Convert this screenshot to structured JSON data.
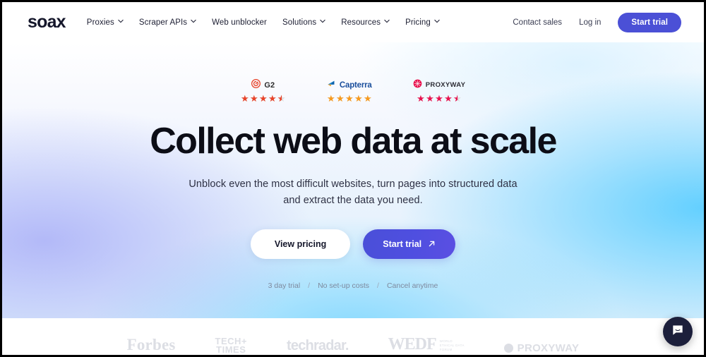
{
  "brand": {
    "logo_text": "soax"
  },
  "nav": {
    "items": [
      {
        "label": "Proxies",
        "has_dropdown": true
      },
      {
        "label": "Scraper APIs",
        "has_dropdown": true
      },
      {
        "label": "Web unblocker",
        "has_dropdown": false
      },
      {
        "label": "Solutions",
        "has_dropdown": true
      },
      {
        "label": "Resources",
        "has_dropdown": true
      },
      {
        "label": "Pricing",
        "has_dropdown": true
      }
    ],
    "contact_sales": "Contact sales",
    "log_in": "Log in",
    "start_trial": "Start trial"
  },
  "badges": [
    {
      "name": "G2",
      "rating": 4.5,
      "star_color": "#e8442a",
      "mark": "g2"
    },
    {
      "name": "Capterra",
      "rating": 5,
      "star_color": "#f79a1e",
      "mark": "capterra"
    },
    {
      "name": "PROXYWAY",
      "rating": 4.5,
      "star_color": "#e8134f",
      "mark": "proxyway"
    }
  ],
  "hero": {
    "headline": "Collect web data at scale",
    "subhead_line1": "Unblock even the most difficult websites, turn pages into structured data",
    "subhead_line2": "and extract the data you need.",
    "cta_primary": "Start trial",
    "cta_secondary": "View pricing",
    "trial_meta": [
      "3 day trial",
      "No set-up costs",
      "Cancel anytime"
    ],
    "trial_separator": "/"
  },
  "logo_strip": {
    "brands": [
      {
        "name": "Forbes",
        "text": "Forbes"
      },
      {
        "name": "Tech Times",
        "line1": "TECH+",
        "line2": "TIMES"
      },
      {
        "name": "techradar",
        "text": "techradar."
      },
      {
        "name": "WEDF",
        "text": "WEDF",
        "sub1": "WORLD",
        "sub2": "ETHICAL DATA",
        "sub3": "FORUM"
      },
      {
        "name": "PROXYWAY",
        "text": "PROXYWAY"
      }
    ]
  },
  "chat": {
    "label": "Open chat"
  },
  "colors": {
    "accent": "#4b50d6",
    "headline": "#0c0d16",
    "chat_bg": "#1c1f3b",
    "logo_gray": "#dcdee4"
  }
}
